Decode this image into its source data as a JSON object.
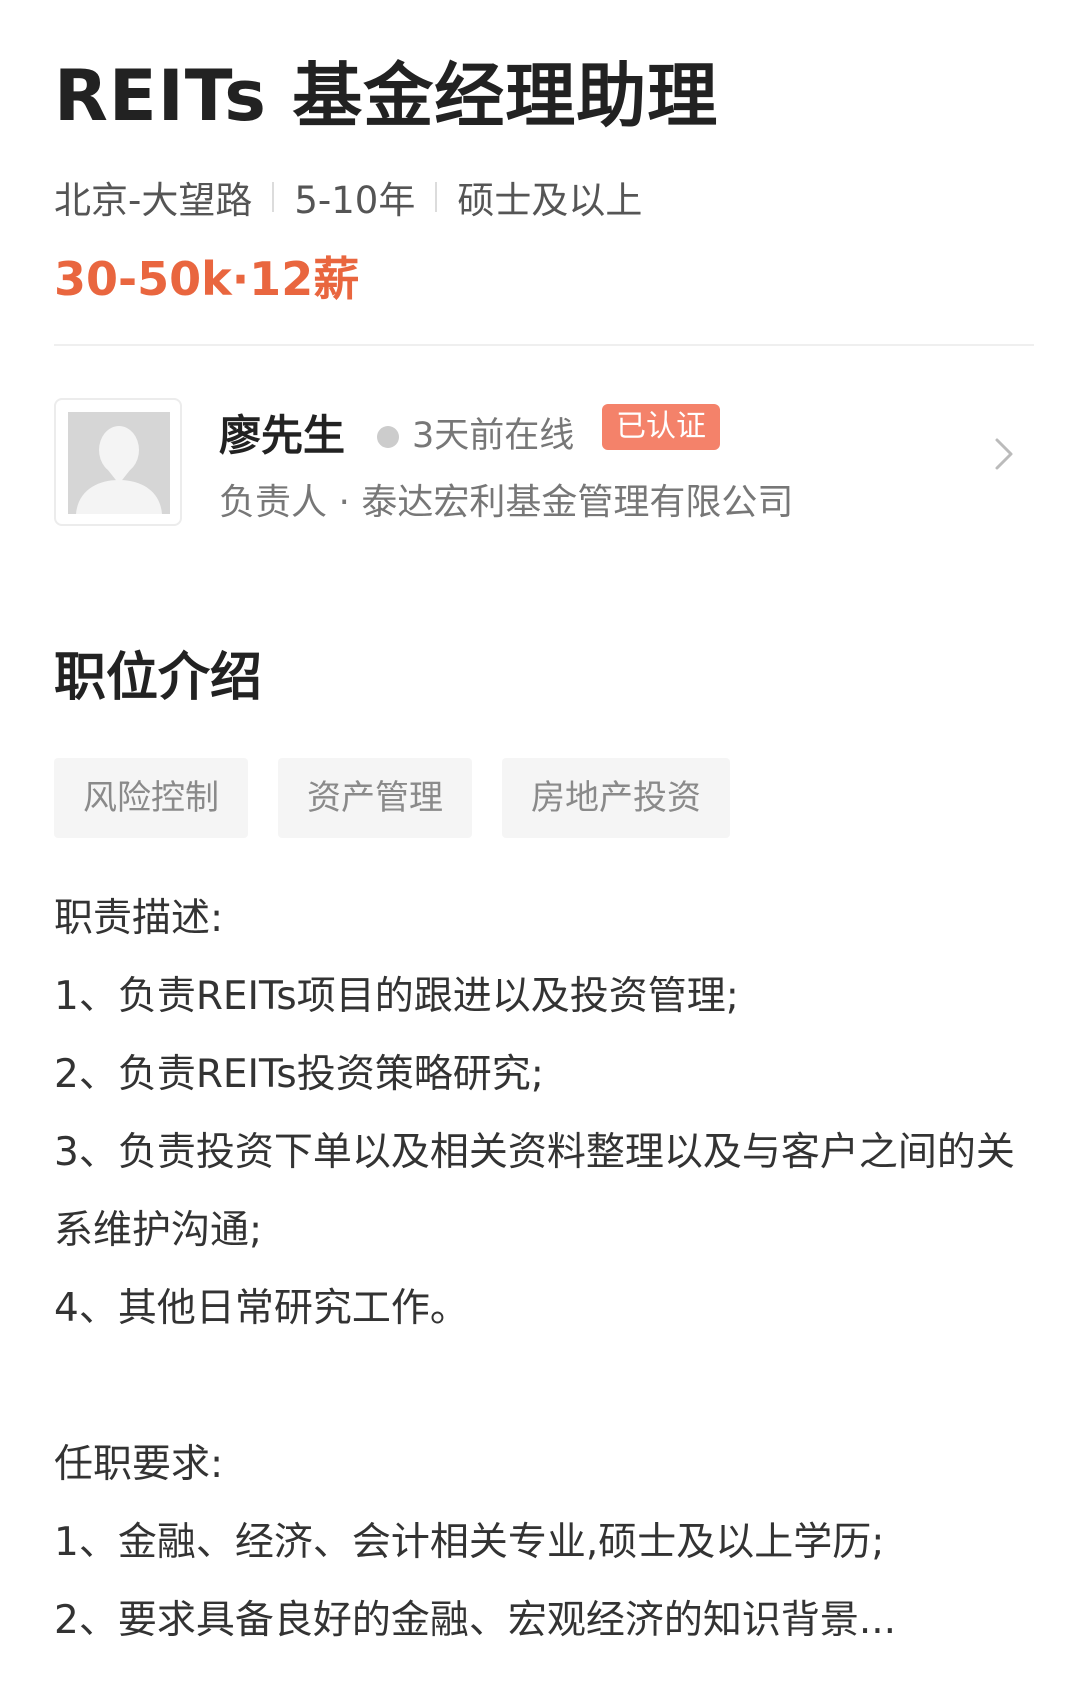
{
  "job": {
    "title": "REITs 基金经理助理",
    "location": "北京-大望路",
    "experience": "5-10年",
    "education": "硕士及以上",
    "salary": "30-50k·12薪"
  },
  "recruiter": {
    "name": "廖先生",
    "online_status": "3天前在线",
    "verified_label": "已认证",
    "role_company": "负责人 · 泰达宏利基金管理有限公司"
  },
  "section": {
    "title": "职位介绍"
  },
  "tags": [
    "风险控制",
    "资产管理",
    "房地产投资"
  ],
  "description": {
    "duties_heading": "职责描述:",
    "duties": [
      "1、负责REITs项目的跟进以及投资管理;",
      "2、负责REITs投资策略研究;",
      "3、负责投资下单以及相关资料整理以及与客户之间的关系维护沟通;",
      "4、其他日常研究工作。"
    ],
    "requirements_heading": "任职要求:",
    "requirements": [
      "1、金融、经济、会计相关专业,硕士及以上学历;",
      "2、要求具备良好的金融、宏观经济的知识背景..."
    ]
  },
  "colors": {
    "salary": "#e9663f",
    "badge": "#f4826a",
    "tag_bg": "#f5f5f5"
  },
  "icons": {
    "avatar": "avatar-placeholder-icon",
    "online": "online-dot-icon",
    "chevron": "chevron-right-icon"
  }
}
